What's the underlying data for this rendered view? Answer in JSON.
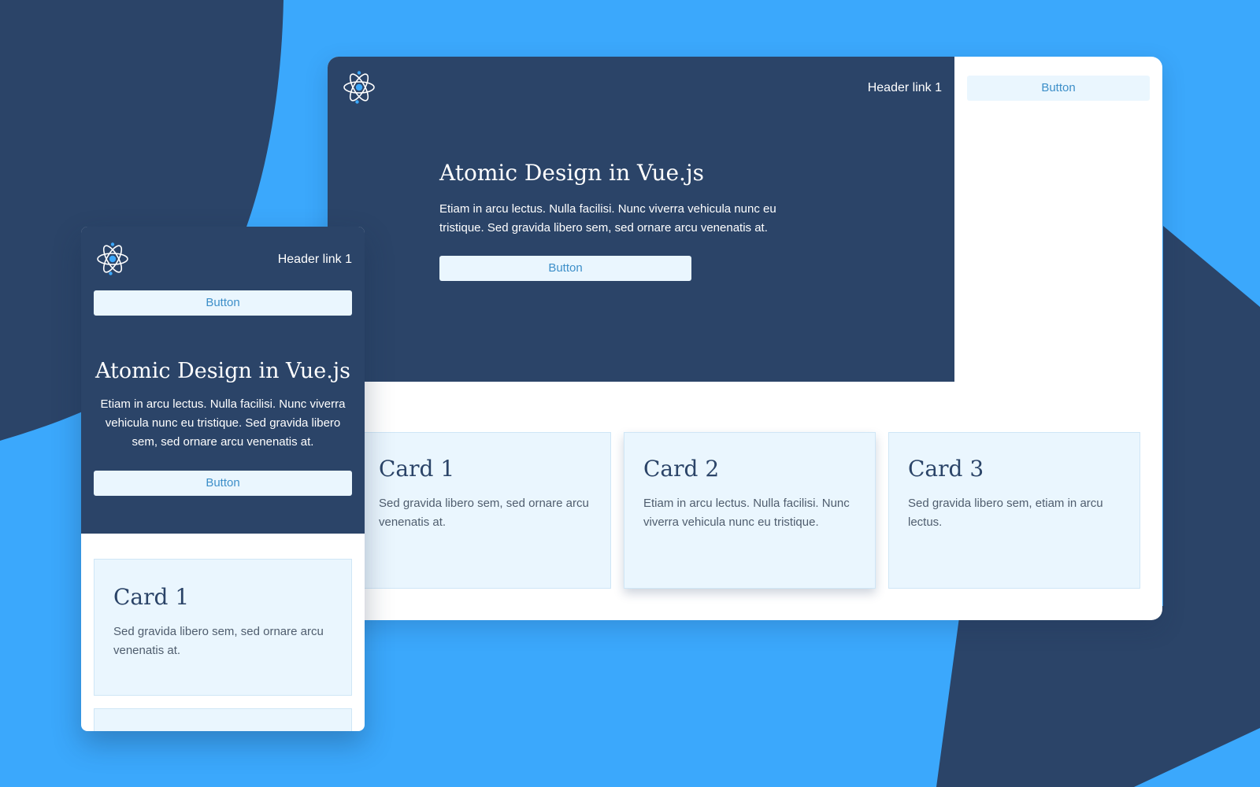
{
  "theme": {
    "background": "#3ba8fc",
    "dark_navy": "#2b4468",
    "card_background": "#eaf6fe",
    "button_text": "#3d8fc9"
  },
  "logo": {
    "icon": "atom-icon"
  },
  "desktop": {
    "header": {
      "link_label": "Header link 1",
      "button_label": "Button"
    },
    "hero": {
      "title": "Atomic Design in Vue.js",
      "text": "Etiam in arcu lectus. Nulla facilisi. Nunc viverra vehicula nunc eu tristique. Sed gravida libero sem, sed ornare arcu venenatis at.",
      "button_label": "Button"
    },
    "cards": [
      {
        "title": "Card 1",
        "text": "Sed gravida libero sem, sed ornare arcu venenatis at."
      },
      {
        "title": "Card 2",
        "text": "Etiam in arcu lectus. Nulla facilisi. Nunc viverra vehicula nunc eu tristique."
      },
      {
        "title": "Card 3",
        "text": "Sed gravida libero sem, etiam in arcu lectus."
      }
    ]
  },
  "mobile": {
    "header": {
      "link_label": "Header link 1",
      "button_label": "Button"
    },
    "hero": {
      "title": "Atomic Design in Vue.js",
      "text": "Etiam in arcu lectus. Nulla facilisi. Nunc viverra vehicula nunc eu tristique. Sed gravida libero sem, sed ornare arcu venenatis at.",
      "button_label": "Button"
    },
    "cards": [
      {
        "title": "Card 1",
        "text": "Sed gravida libero sem, sed ornare arcu venenatis at."
      }
    ]
  }
}
